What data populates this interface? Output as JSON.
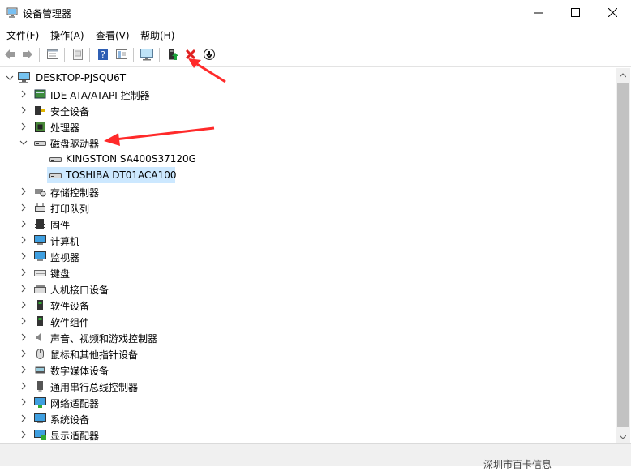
{
  "window": {
    "title": "设备管理器",
    "minimize_glyph": "—",
    "maximize_glyph": "☐",
    "close_glyph": "✕"
  },
  "menu": [
    {
      "label": "文件(F)"
    },
    {
      "label": "操作(A)"
    },
    {
      "label": "查看(V)"
    },
    {
      "label": "帮助(H)"
    }
  ],
  "toolbar": {
    "icons": [
      "back-icon",
      "forward-icon",
      "properties-icon",
      "show-hidden-icon",
      "help-icon",
      "view-icon",
      "monitor-scan-icon",
      "update-driver-icon",
      "uninstall-icon",
      "disable-icon"
    ]
  },
  "tree": {
    "root": "DESKTOP-PJSQU6T",
    "items": [
      {
        "label": "IDE ATA/ATAPI 控制器",
        "icon": "ide-controller-icon",
        "expanded": false
      },
      {
        "label": "安全设备",
        "icon": "security-device-icon",
        "expanded": false
      },
      {
        "label": "处理器",
        "icon": "processor-icon",
        "expanded": false
      },
      {
        "label": "磁盘驱动器",
        "icon": "disk-drive-icon",
        "expanded": true,
        "children": [
          {
            "label": "KINGSTON SA400S37120G",
            "icon": "disk-icon",
            "selected": false
          },
          {
            "label": "TOSHIBA DT01ACA100",
            "icon": "disk-icon",
            "selected": true
          }
        ]
      },
      {
        "label": "存储控制器",
        "icon": "storage-controller-icon",
        "expanded": false
      },
      {
        "label": "打印队列",
        "icon": "printer-icon",
        "expanded": false
      },
      {
        "label": "固件",
        "icon": "firmware-icon",
        "expanded": false
      },
      {
        "label": "计算机",
        "icon": "computer-icon",
        "expanded": false
      },
      {
        "label": "监视器",
        "icon": "monitor-icon",
        "expanded": false
      },
      {
        "label": "键盘",
        "icon": "keyboard-icon",
        "expanded": false
      },
      {
        "label": "人机接口设备",
        "icon": "hid-icon",
        "expanded": false
      },
      {
        "label": "软件设备",
        "icon": "software-device-icon",
        "expanded": false
      },
      {
        "label": "软件组件",
        "icon": "software-component-icon",
        "expanded": false
      },
      {
        "label": "声音、视频和游戏控制器",
        "icon": "sound-icon",
        "expanded": false
      },
      {
        "label": "鼠标和其他指针设备",
        "icon": "mouse-icon",
        "expanded": false
      },
      {
        "label": "数字媒体设备",
        "icon": "media-device-icon",
        "expanded": false
      },
      {
        "label": "通用串行总线控制器",
        "icon": "usb-icon",
        "expanded": false
      },
      {
        "label": "网络适配器",
        "icon": "network-adapter-icon",
        "expanded": false
      },
      {
        "label": "系统设备",
        "icon": "system-device-icon",
        "expanded": false
      },
      {
        "label": "显示适配器",
        "icon": "display-adapter-icon",
        "expanded": false
      }
    ]
  },
  "status": {
    "text": "深圳市百卡信息"
  },
  "colors": {
    "annotation": "#ff2a2a",
    "selection": "#cce8ff",
    "uninstall": "#e02020"
  }
}
